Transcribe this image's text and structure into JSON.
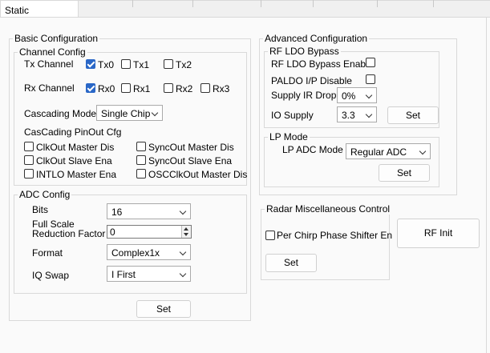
{
  "tab": {
    "label": "Static Configuration"
  },
  "basic": {
    "title": "Basic Configuration",
    "channel_config": {
      "title": "Channel Config",
      "tx_label": "Tx Channel",
      "tx": [
        {
          "label": "Tx0",
          "checked": true
        },
        {
          "label": "Tx1",
          "checked": false
        },
        {
          "label": "Tx2",
          "checked": false
        }
      ],
      "rx_label": "Rx Channel",
      "rx": [
        {
          "label": "Rx0",
          "checked": true
        },
        {
          "label": "Rx1",
          "checked": false
        },
        {
          "label": "Rx2",
          "checked": false
        },
        {
          "label": "Rx3",
          "checked": false
        }
      ],
      "cascading_mode_label": "Cascading Mode",
      "cascading_mode_value": "Single Chip",
      "pinout_title": "CasCading PinOut Cfg",
      "pinout": [
        {
          "label": "ClkOut Master Dis",
          "checked": false
        },
        {
          "label": "SyncOut Master Dis",
          "checked": false
        },
        {
          "label": "ClkOut Slave Ena",
          "checked": false
        },
        {
          "label": "SyncOut Slave Ena",
          "checked": false
        },
        {
          "label": "INTLO Master Ena",
          "checked": false
        },
        {
          "label": "OSCClkOut Master Dis",
          "checked": false
        }
      ]
    },
    "adc_config": {
      "title": "ADC Config",
      "bits_label": "Bits",
      "bits_value": "16",
      "fsr_label_1": "Full Scale",
      "fsr_label_2": "Reduction Factor",
      "fsr_value": "0",
      "format_label": "Format",
      "format_value": "Complex1x",
      "iq_label": "IQ Swap",
      "iq_value": "I First"
    },
    "set_label": "Set"
  },
  "advanced": {
    "title": "Advanced Configuration",
    "rf_ldo": {
      "title": "RF LDO Bypass",
      "bypass_label": "RF LDO Bypass Enable",
      "bypass_checked": false,
      "paldo_label": "PALDO I/P Disable",
      "paldo_checked": false,
      "ir_drop_label": "Supply IR Drop",
      "ir_drop_value": "0%",
      "io_supply_label": "IO Supply",
      "io_supply_value": "3.3",
      "set_label": "Set"
    },
    "lp_mode": {
      "title": "LP Mode",
      "adc_mode_label": "LP ADC Mode",
      "adc_mode_value": "Regular ADC",
      "set_label": "Set"
    }
  },
  "radar_misc": {
    "title": "Radar Miscellaneous Control",
    "phase_shifter_label": "Per Chirp Phase Shifter En",
    "phase_shifter_checked": false,
    "set_label": "Set"
  },
  "rf_init": {
    "label": "RF Init"
  }
}
